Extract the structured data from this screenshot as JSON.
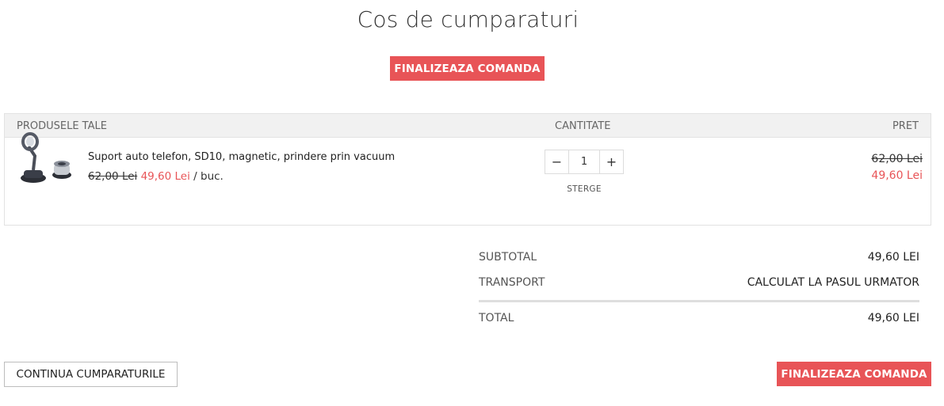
{
  "page": {
    "title": "Cos de cumparaturi"
  },
  "actions": {
    "checkout_top_label": "FINALIZEAZA COMANDA",
    "checkout_bottom_label": "FINALIZEAZA COMANDA",
    "continue_label": "CONTINUA CUMPARATURILE"
  },
  "table": {
    "headers": {
      "products": "PRODUSELE TALE",
      "quantity": "CANTITATE",
      "price": "PRET"
    },
    "items": [
      {
        "name": "Suport auto telefon, SD10, magnetic, prindere prin vacuum",
        "unit_old_price": "62,00 Lei",
        "unit_new_price": "49,60 Lei",
        "unit_suffix": "/ buc.",
        "quantity": "1",
        "remove_label": "STERGE",
        "total_old_price": "62,00 Lei",
        "total_new_price": "49,60 Lei"
      }
    ]
  },
  "summary": {
    "subtotal_label": "SUBTOTAL",
    "subtotal_value": "49,60 LEI",
    "transport_label": "TRANSPORT",
    "transport_value": "CALCULAT LA PASUL URMATOR",
    "total_label": "TOTAL",
    "total_value": "49,60 LEI"
  },
  "colors": {
    "accent": "#e85457",
    "header_bg": "#f1f1f1",
    "border": "#e2e2e2"
  },
  "icons": {
    "minus": "minus-icon",
    "plus": "plus-icon",
    "product_image": "car-phone-holder-image"
  }
}
